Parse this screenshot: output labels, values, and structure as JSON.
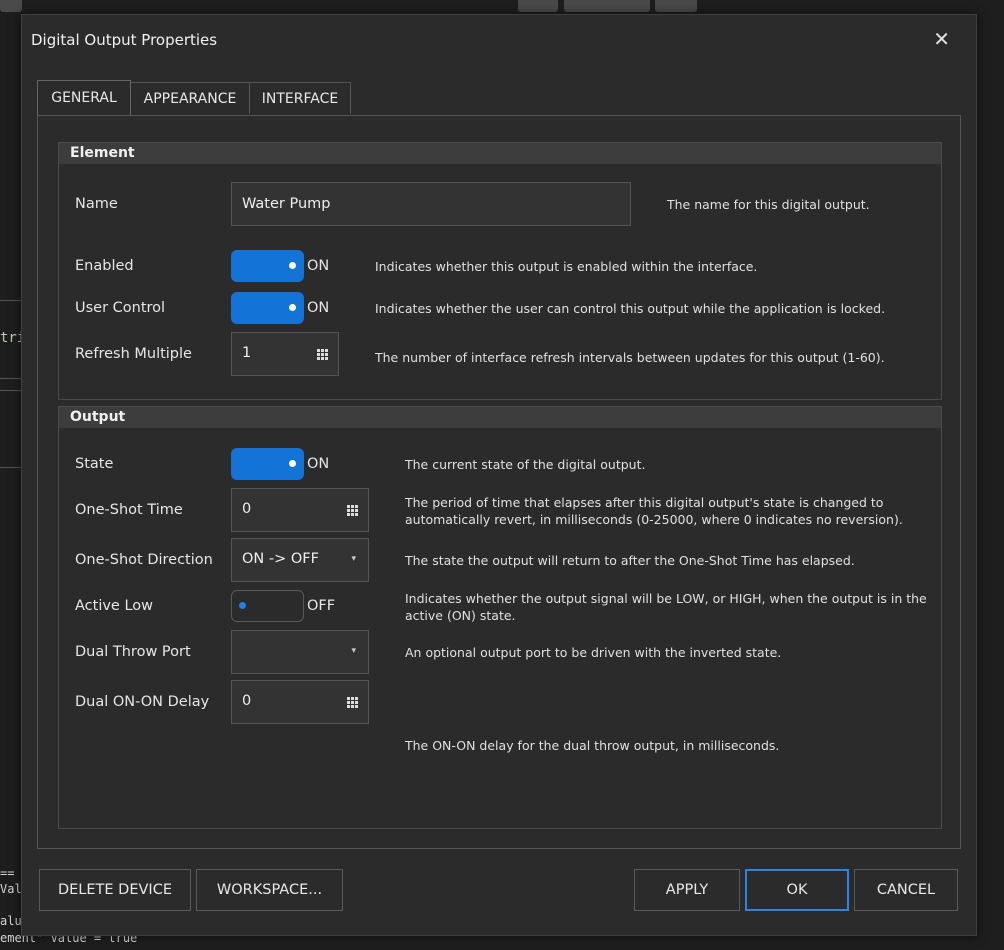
{
  "dialog": {
    "title": "Digital Output Properties",
    "close_glyph": "✕"
  },
  "tabs": [
    {
      "label": "GENERAL",
      "active": true
    },
    {
      "label": "APPEARANCE",
      "active": false
    },
    {
      "label": "INTERFACE",
      "active": false
    }
  ],
  "element_group": {
    "header": "Element",
    "name": {
      "label": "Name",
      "value": "Water Pump",
      "desc": "The name for this digital output."
    },
    "enabled": {
      "label": "Enabled",
      "state": "ON",
      "desc": "Indicates whether this output is enabled within the interface."
    },
    "user_control": {
      "label": "User Control",
      "state": "ON",
      "desc": "Indicates whether the user can control this output while the application is locked."
    },
    "refresh_multiple": {
      "label": "Refresh Multiple",
      "value": "1",
      "desc": "The number of interface refresh intervals between updates for this output (1-60)."
    }
  },
  "output_group": {
    "header": "Output",
    "state": {
      "label": "State",
      "state": "ON",
      "desc": "The current state of the digital output."
    },
    "one_shot_time": {
      "label": "One-Shot Time",
      "value": "0",
      "desc": "The period of time that elapses after this digital output's state is changed to automatically revert, in milliseconds (0-25000, where 0 indicates no reversion)."
    },
    "one_shot_direction": {
      "label": "One-Shot Direction",
      "value": "ON -> OFF",
      "desc": "The state the output will return to after the One-Shot Time has elapsed."
    },
    "active_low": {
      "label": "Active Low",
      "state": "OFF",
      "desc": "Indicates whether the output signal will be LOW, or HIGH, when the output is in the active (ON) state."
    },
    "dual_throw_port": {
      "label": "Dual Throw Port",
      "value": "",
      "desc": "An optional output port to be driven with the inverted state."
    },
    "dual_on_on_delay": {
      "label": "Dual ON-ON Delay",
      "value": "0",
      "desc": "The ON-ON delay for the dual throw output, in milliseconds."
    }
  },
  "buttons": {
    "delete_device": "DELETE DEVICE",
    "workspace": "WORKSPACE...",
    "apply": "APPLY",
    "ok": "OK",
    "cancel": "CANCEL"
  },
  "background": {
    "green_text": "trik",
    "code_lines": [
      "==",
      "Val",
      "",
      "alu",
      "ement\" Value = true"
    ]
  },
  "colors": {
    "accent": "#1473d6",
    "dialog_bg": "#2b2b2b",
    "group_header_bg": "#3d3d3d"
  },
  "icons": {
    "close": "close-icon",
    "keypad": "keypad-icon",
    "dropdown": "chevron-down-icon"
  }
}
